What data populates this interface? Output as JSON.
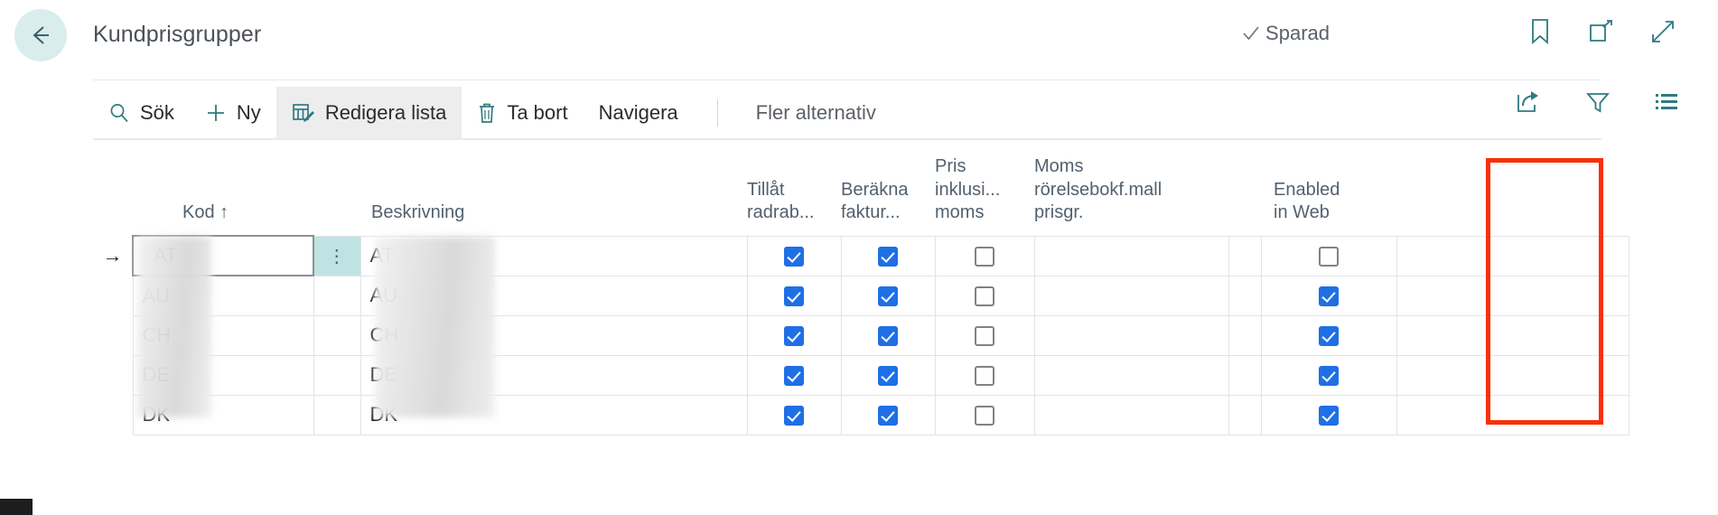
{
  "header": {
    "back_label": "Back",
    "title": "Kundprisgrupper",
    "saved_label": "Sparad",
    "icons": [
      {
        "name": "bookmark-icon",
        "label": "Bookmark"
      },
      {
        "name": "open-in-new-window-icon",
        "label": "Open in new window"
      },
      {
        "name": "expand-icon",
        "label": "Expand"
      }
    ]
  },
  "toolbar": {
    "items": [
      {
        "label": "Sök",
        "icon": "search-icon",
        "active": false
      },
      {
        "label": "Ny",
        "icon": "plus-icon",
        "active": false
      },
      {
        "label": "Redigera lista",
        "icon": "edit-list-icon",
        "active": true
      },
      {
        "label": "Ta bort",
        "icon": "trash-icon",
        "active": false
      },
      {
        "label": "Navigera",
        "icon": "none",
        "active": false
      }
    ],
    "more_label": "Fler alternativ",
    "right_icons": [
      {
        "name": "share-icon",
        "label": "Share"
      },
      {
        "name": "filter-icon",
        "label": "Filter"
      },
      {
        "name": "list-options-icon",
        "label": "List options"
      }
    ]
  },
  "table": {
    "columns": [
      {
        "key": "indicator",
        "label": ""
      },
      {
        "key": "kod",
        "label": "Kod ↑",
        "sorted": "asc"
      },
      {
        "key": "dots",
        "label": ""
      },
      {
        "key": "beskrivning",
        "label": "Beskrivning"
      },
      {
        "key": "tillat_radrab",
        "label": "Tillåt radrab..."
      },
      {
        "key": "berakna_faktur",
        "label": "Beräkna faktur..."
      },
      {
        "key": "pris_inkl_moms",
        "label": "Pris inklusi... moms"
      },
      {
        "key": "moms_rorelsebokf",
        "label": "Moms rörelsebokf.mall prisgr."
      },
      {
        "key": "gap",
        "label": ""
      },
      {
        "key": "enabled_in_web",
        "label": "Enabled in Web"
      },
      {
        "key": "tail",
        "label": ""
      }
    ],
    "column_labels": {
      "kod_line1": "Kod ↑",
      "beskrivning_line1": "Beskrivning",
      "tillat_line1": "Tillåt",
      "tillat_line2": "radrab...",
      "berakna_line1": "Beräkna",
      "berakna_line2": "faktur...",
      "pris_line1": "Pris",
      "pris_line2": "inklusi...",
      "pris_line3": "moms",
      "moms_line1": "Moms",
      "moms_line2": "rörelsebokf.mall",
      "moms_line3": "prisgr.",
      "web_line1": "Enabled",
      "web_line2": "in Web"
    },
    "rows": [
      {
        "indicator": "→",
        "kod": "AT",
        "kod_masked": true,
        "selected": true,
        "dots": "⋮",
        "beskrivning": "AT",
        "beskrivning_masked": true,
        "tillat_radrab": true,
        "berakna_faktur": true,
        "pris_inkl_moms": false,
        "moms_rorelsebokf": "",
        "enabled_in_web": false
      },
      {
        "indicator": "",
        "kod": "AU",
        "kod_masked": true,
        "selected": false,
        "dots": "",
        "beskrivning": "AU",
        "beskrivning_masked": true,
        "tillat_radrab": true,
        "berakna_faktur": true,
        "pris_inkl_moms": false,
        "moms_rorelsebokf": "",
        "enabled_in_web": true
      },
      {
        "indicator": "",
        "kod": "CH",
        "kod_masked": true,
        "selected": false,
        "dots": "",
        "beskrivning": "CH",
        "beskrivning_masked": true,
        "tillat_radrab": true,
        "berakna_faktur": true,
        "pris_inkl_moms": false,
        "moms_rorelsebokf": "",
        "enabled_in_web": true
      },
      {
        "indicator": "",
        "kod": "DE",
        "kod_masked": true,
        "selected": false,
        "dots": "",
        "beskrivning": "DE",
        "beskrivning_masked": true,
        "tillat_radrab": true,
        "berakna_faktur": true,
        "pris_inkl_moms": false,
        "moms_rorelsebokf": "",
        "enabled_in_web": true
      },
      {
        "indicator": "",
        "kod": "DK",
        "kod_masked": true,
        "selected": false,
        "dots": "",
        "beskrivning": "DK",
        "beskrivning_masked": true,
        "tillat_radrab": true,
        "berakna_faktur": true,
        "pris_inkl_moms": false,
        "moms_rorelsebokf": "",
        "enabled_in_web": true
      }
    ]
  },
  "annotation": {
    "name": "red-highlight-box",
    "color": "#f8300a",
    "targets_column": "Enabled in Web"
  },
  "colors": {
    "accent_teal": "#2e7b7f",
    "checkbox_blue": "#1f6fe5",
    "back_circle": "#d9eded",
    "dots_cell": "#bfe3e3",
    "annotation_red": "#f8300a",
    "header_text": "#53606e"
  }
}
